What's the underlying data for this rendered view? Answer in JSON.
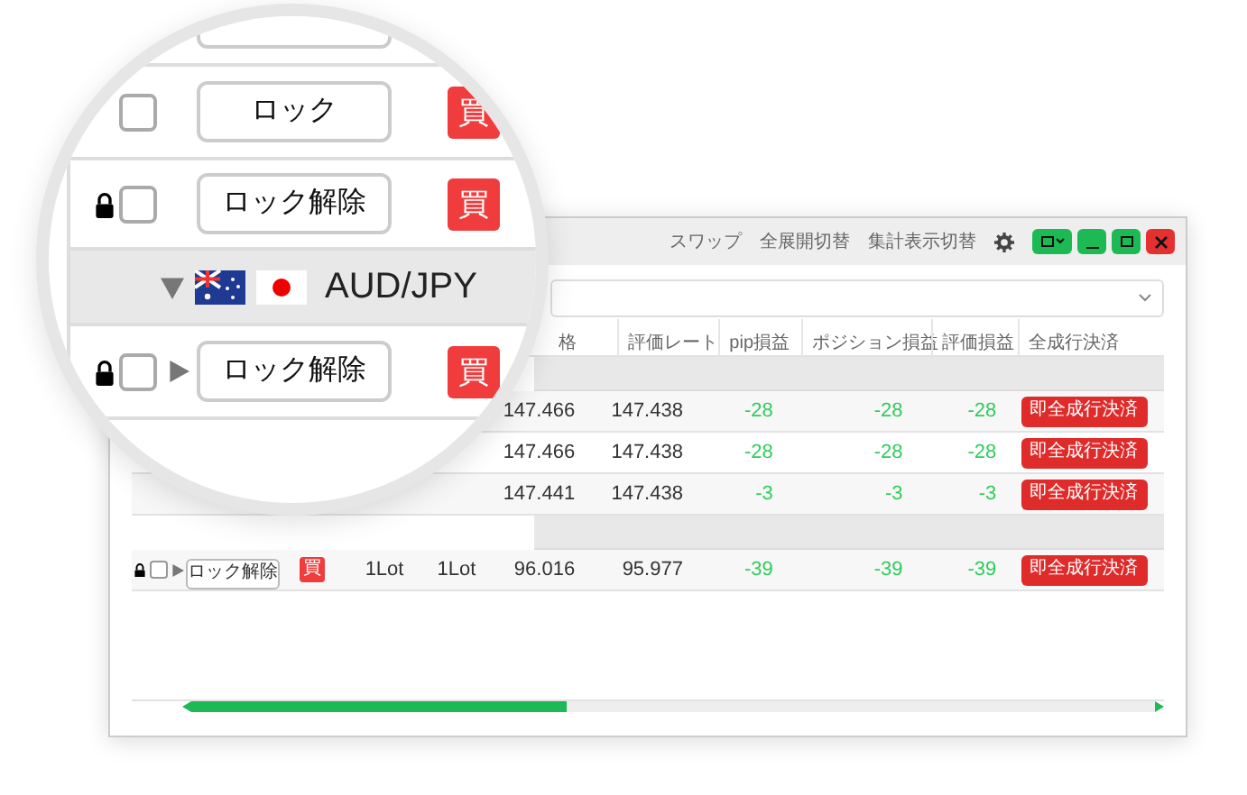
{
  "toolbar": {
    "links": [
      "スワップ",
      "全展開切替",
      "集計表示切替"
    ]
  },
  "table": {
    "columns": [
      {
        "label": "格"
      },
      {
        "label": "評価レート"
      },
      {
        "label": "pip損益"
      },
      {
        "label": "ポジション損益"
      },
      {
        "label": "評価損益"
      },
      {
        "label": "全成行決済"
      }
    ],
    "rows": [
      {
        "kind": "group"
      },
      {
        "kind": "position",
        "price": "147.466",
        "rate": "147.438",
        "pip": "-28",
        "position_pl": "-28",
        "eval_pl": "-28",
        "close_button": "即全成行決済"
      },
      {
        "kind": "position",
        "price": "147.466",
        "rate": "147.438",
        "pip": "-28",
        "position_pl": "-28",
        "eval_pl": "-28",
        "close_button": "即全成行決済"
      },
      {
        "kind": "position",
        "price": "147.441",
        "rate": "147.438",
        "pip": "-3",
        "position_pl": "-3",
        "eval_pl": "-3",
        "close_button": "即全成行決済"
      },
      {
        "kind": "group"
      },
      {
        "kind": "position",
        "locked": true,
        "checked": false,
        "expandable": true,
        "lock_button": "ロック解除",
        "side": "買",
        "lot": "1Lot",
        "lot_2": "1Lot",
        "price": "96.016",
        "rate": "95.977",
        "pip": "-39",
        "position_pl": "-39",
        "eval_pl": "-39",
        "close_button": "即全成行決済"
      }
    ]
  },
  "magnifier": {
    "rows": [
      {
        "kind": "cut"
      },
      {
        "kind": "position",
        "locked": false,
        "checked": false,
        "lock_button": "ロック",
        "side": "買"
      },
      {
        "kind": "position",
        "locked": true,
        "checked": false,
        "lock_button": "ロック解除",
        "side": "買"
      },
      {
        "kind": "group",
        "expanded": true,
        "pair": "AUD/JPY"
      },
      {
        "kind": "position",
        "locked": true,
        "checked": false,
        "expandable": true,
        "lock_button": "ロック解除",
        "side": "買"
      }
    ]
  }
}
